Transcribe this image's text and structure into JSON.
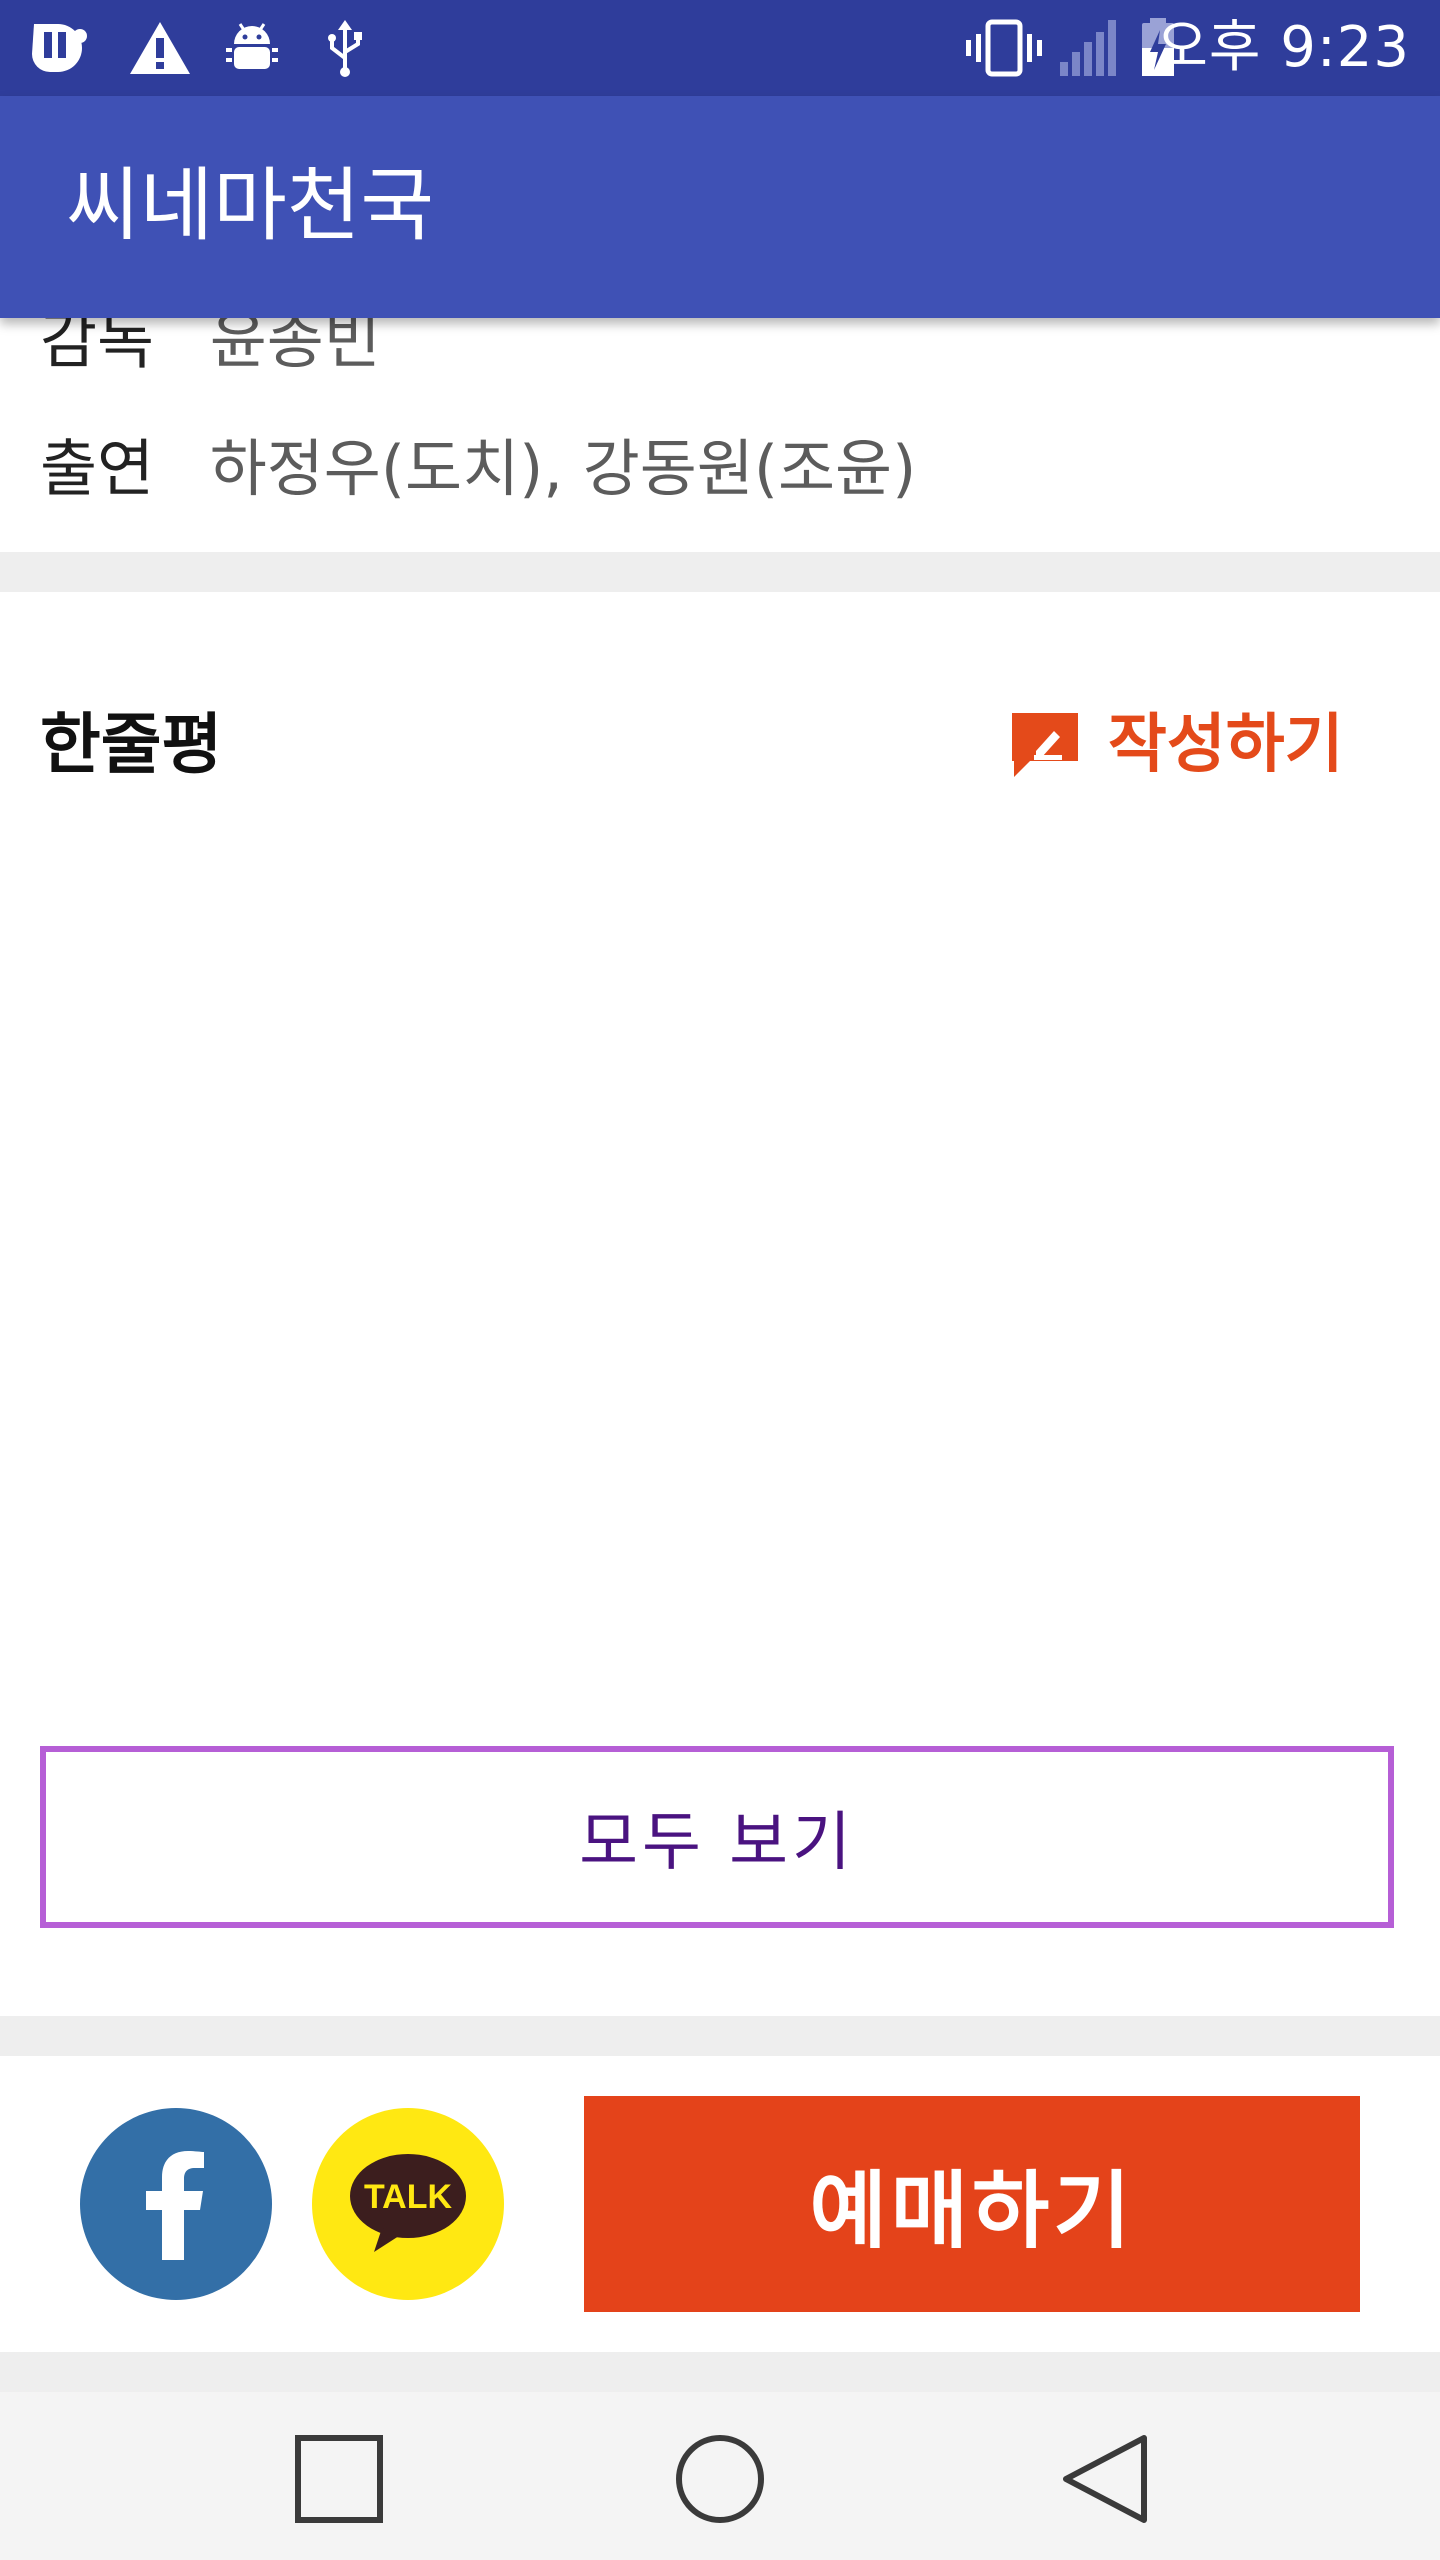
{
  "status_bar": {
    "time": "오후 9:23",
    "icons": [
      "uplus-icon",
      "warning-icon",
      "android-debug-icon",
      "usb-icon",
      "vibrate-icon",
      "signal-icon",
      "battery-charging-icon"
    ]
  },
  "app_bar": {
    "title": "씨네마천국"
  },
  "movie_info": {
    "director_label": "감독",
    "director_value": "윤종빈",
    "cast_label": "출연",
    "cast_value": "하정우(도치), 강동원(조윤)"
  },
  "reviews": {
    "title": "한줄평",
    "write_label": "작성하기",
    "view_all_label": "모두 보기"
  },
  "share": {
    "facebook_icon": "facebook-icon",
    "kakao_text": "TALK"
  },
  "booking": {
    "button_label": "예매하기"
  },
  "colors": {
    "status_bar": "#2f3d9b",
    "app_bar": "#3f51b5",
    "accent_orange": "#e4431a",
    "view_all_border": "#b65fd6",
    "view_all_text": "#4a1380",
    "facebook": "#336fa7",
    "kakao": "#ffe812"
  },
  "nav_bar": {
    "icons": [
      "recent-apps-icon",
      "home-icon",
      "back-icon"
    ]
  }
}
